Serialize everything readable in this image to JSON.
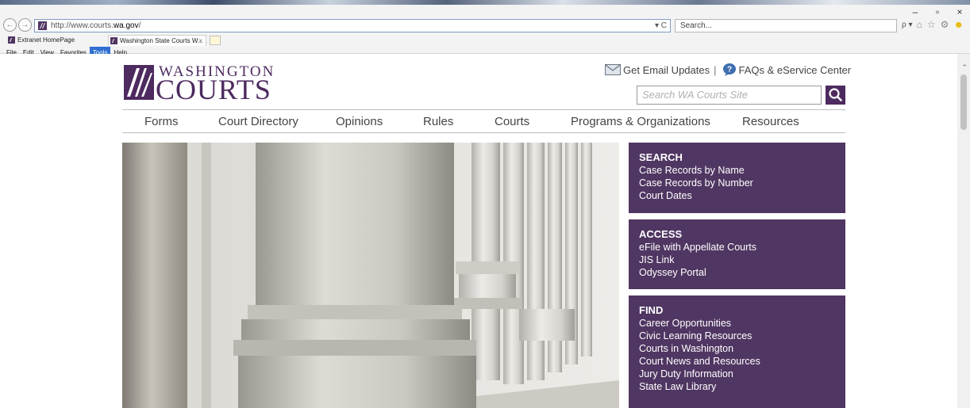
{
  "browser": {
    "window_controls": {
      "minimize": "–",
      "restore": "▫",
      "close": "×"
    },
    "address_url_prefix": "http://www.courts.",
    "address_url_host": "wa.gov",
    "address_url_suffix": "/",
    "address_tools": "▾ C",
    "search_placeholder": "Search...",
    "search_dropdown": "ρ ▾",
    "tabs": [
      {
        "title": "Extranet HomePage"
      },
      {
        "title": "Washington State Courts W...",
        "close": "×"
      }
    ],
    "menu": [
      "File",
      "Edit",
      "View",
      "Favorites",
      "Tools",
      "Help"
    ],
    "active_menu": "Tools",
    "toolbar_icons": [
      "home-icon",
      "favorites-star-icon",
      "settings-gear-icon",
      "smiley-feedback-icon"
    ]
  },
  "site": {
    "logo_top": "WASHINGTON",
    "logo_bottom": "COURTS",
    "utility": {
      "email_updates": "Get Email Updates",
      "separator": "|",
      "faqs": "FAQs & eService Center"
    },
    "search_placeholder": "Search WA Courts Site",
    "nav": [
      "Forms",
      "Court Directory",
      "Opinions",
      "Rules",
      "Courts",
      "Programs & Organizations",
      "Resources"
    ],
    "panels": [
      {
        "heading": "SEARCH",
        "links": [
          "Case Records by Name",
          "Case Records by Number",
          "Court Dates"
        ]
      },
      {
        "heading": "ACCESS",
        "links": [
          "eFile with Appellate Courts",
          "JIS Link",
          "Odyssey Portal"
        ]
      },
      {
        "heading": "FIND",
        "links": [
          "Career Opportunities",
          "Civic Learning Resources",
          "Courts in Washington",
          "Court News and Resources",
          "Jury Duty Information",
          "State Law Library"
        ]
      }
    ]
  },
  "colors": {
    "brand_purple": "#503662",
    "logo_purple": "#4d2a5f",
    "menu_highlight": "#2f6fd0"
  }
}
